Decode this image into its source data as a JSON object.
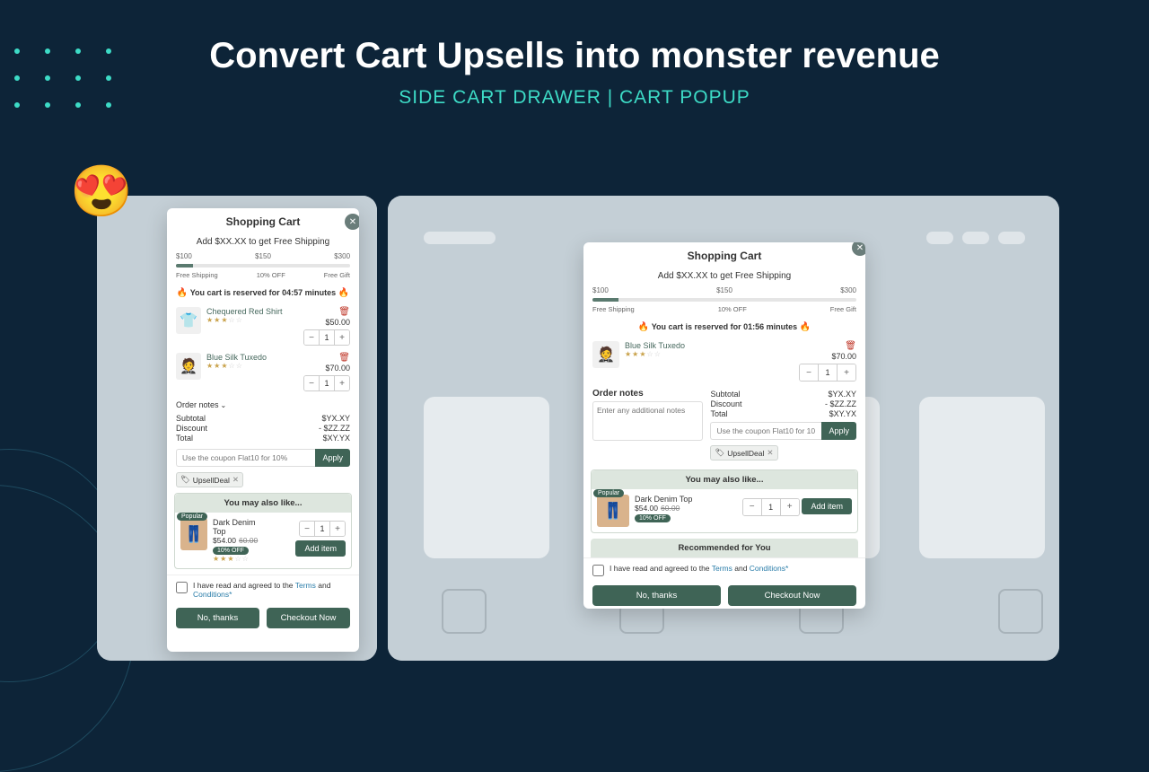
{
  "hero": {
    "headline": "Convert Cart Upsells into monster revenue",
    "sub": "SIDE CART DRAWER | CART POPUP"
  },
  "common": {
    "cart_title": "Shopping Cart",
    "ship_msg": "Add $XX.XX to get Free Shipping",
    "tiers": [
      "$100",
      "$150",
      "$300"
    ],
    "tier_labels": [
      "Free Shipping",
      "10% OFF",
      "Free Gift"
    ],
    "notes_label": "Order notes",
    "notes_placeholder": "Enter any additional notes",
    "subtotal_label": "Subtotal",
    "discount_label": "Discount",
    "total_label": "Total",
    "subtotal_val": "$YX.XY",
    "discount_val": "- $ZZ.ZZ",
    "total_val": "$XY.YX",
    "coupon_placeholder": "Use the coupon Flat10 for 10%",
    "coupon_placeholder_short": "Use the coupon Flat10 for 10",
    "apply": "Apply",
    "upsell_deal": "UpsellDeal",
    "you_may": "You may also like...",
    "recommended": "Recommended for You",
    "popular": "Popular",
    "off10": "10% OFF",
    "add_item": "Add item",
    "terms_pre": "I have read and agreed to the ",
    "terms": "Terms",
    "terms_and": " and ",
    "conditions": "Conditions*",
    "no_thanks": "No, thanks",
    "checkout": "Checkout Now"
  },
  "left": {
    "reserve": "You cart is reserved for 04:57 minutes",
    "items": [
      {
        "name": "Chequered Red Shirt",
        "price": "$50.00",
        "qty": "1"
      },
      {
        "name": "Blue Silk Tuxedo",
        "price": "$70.00",
        "qty": "1"
      }
    ],
    "upsell_item": {
      "name": "Dark Denim Top",
      "price": "$54.00",
      "old": "60.00",
      "qty": "1"
    }
  },
  "right": {
    "reserve": "You cart is reserved for 01:56 minutes",
    "items": [
      {
        "name": "Blue Silk Tuxedo",
        "price": "$70.00",
        "qty": "1"
      }
    ],
    "upsell_item": {
      "name": "Dark Denim Top",
      "price": "$54.00",
      "old": "60.00",
      "qty": "1"
    }
  }
}
